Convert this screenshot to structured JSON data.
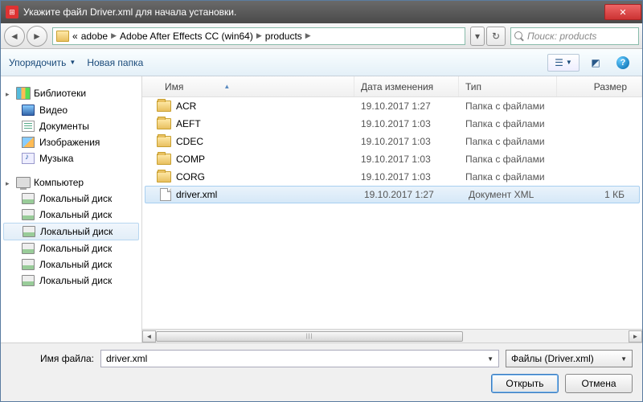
{
  "title": "Укажите файл Driver.xml для начала установки.",
  "breadcrumbs": {
    "prefix": "«",
    "p1": "adobe",
    "p2": "Adobe After Effects CC (win64)",
    "p3": "products"
  },
  "search": {
    "placeholder": "Поиск: products"
  },
  "toolbar": {
    "organize": "Упорядочить",
    "new_folder": "Новая папка"
  },
  "sidebar": {
    "libraries": {
      "label": "Библиотеки",
      "video": "Видео",
      "documents": "Документы",
      "pictures": "Изображения",
      "music": "Музыка"
    },
    "computer": {
      "label": "Компьютер",
      "disk": "Локальный диск"
    }
  },
  "columns": {
    "name": "Имя",
    "date": "Дата изменения",
    "type": "Тип",
    "size": "Размер"
  },
  "type_folder": "Папка с файлами",
  "type_xml": "Документ XML",
  "files": [
    {
      "name": "ACR",
      "date": "19.10.2017 1:27",
      "kind": "folder",
      "size": ""
    },
    {
      "name": "AEFT",
      "date": "19.10.2017 1:03",
      "kind": "folder",
      "size": ""
    },
    {
      "name": "CDEC",
      "date": "19.10.2017 1:03",
      "kind": "folder",
      "size": ""
    },
    {
      "name": "COMP",
      "date": "19.10.2017 1:03",
      "kind": "folder",
      "size": ""
    },
    {
      "name": "CORG",
      "date": "19.10.2017 1:03",
      "kind": "folder",
      "size": ""
    },
    {
      "name": "driver.xml",
      "date": "19.10.2017 1:27",
      "kind": "xml",
      "size": "1 КБ",
      "selected": true
    }
  ],
  "bottom": {
    "filename_label": "Имя файла:",
    "filename_value": "driver.xml",
    "filter": "Файлы (Driver.xml)",
    "open": "Открыть",
    "cancel": "Отмена"
  }
}
